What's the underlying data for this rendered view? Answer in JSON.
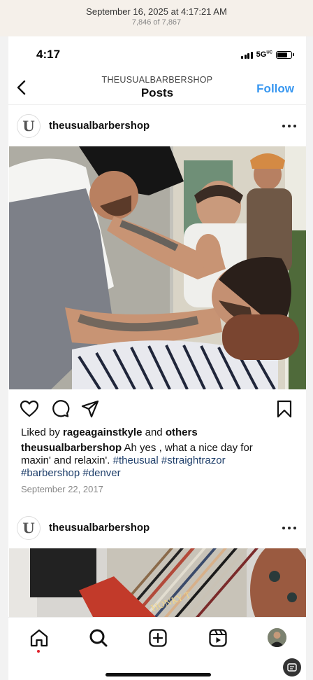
{
  "capture": {
    "datetime": "September 16, 2025 at 4:17:21 AM",
    "counter": "7,846 of 7,867"
  },
  "status_bar": {
    "time": "4:17",
    "network": "5G",
    "network_sub": "UC"
  },
  "header": {
    "account": "THEUSUALBARBERSHOP",
    "title": "Posts",
    "follow_label": "Follow",
    "back_icon": "chevron-left-icon"
  },
  "posts": [
    {
      "avatar_letter": "U",
      "username": "theusualbarbershop",
      "photo_description_icon": "barber-photo",
      "liked_prefix": "Liked by ",
      "liked_user": "rageagainstkyle",
      "liked_middle": " and ",
      "liked_others": "others",
      "caption_user": "theusualbarbershop",
      "caption_text": " Ah yes , what a nice day for maxin' and relaxin'. ",
      "hashtags": [
        "#theusual",
        "#straightrazor",
        "#barbershop",
        "#denver"
      ],
      "date": "September 22, 2017"
    },
    {
      "avatar_letter": "U",
      "username": "theusualbarbershop"
    }
  ],
  "actions": {
    "like_icon": "heart-icon",
    "comment_icon": "comment-icon",
    "share_icon": "send-icon",
    "save_icon": "bookmark-icon"
  },
  "tab_bar": {
    "items": [
      "home-icon",
      "search-icon",
      "create-icon",
      "reels-icon",
      "profile-avatar"
    ]
  },
  "colors": {
    "accent": "#3897f0",
    "hashtag": "#1f3f6b",
    "notification_dot": "#e0202a"
  }
}
